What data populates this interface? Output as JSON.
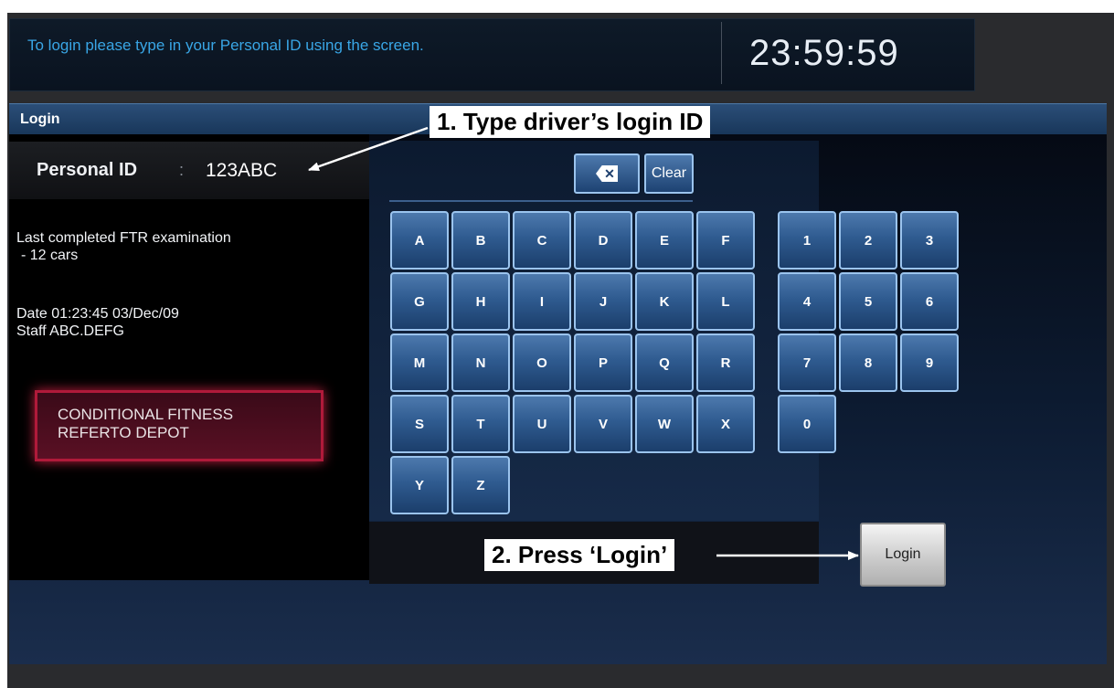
{
  "header": {
    "instruction": "To login please type in your Personal ID using the screen.",
    "clock": "23:59:59"
  },
  "login_panel": {
    "title": "Login",
    "personal_id_label": "Personal ID",
    "personal_id_colon": ":",
    "personal_id_value": "123ABC",
    "last_exam_line1": "Last completed FTR examination",
    "last_exam_line2": "- 12 cars",
    "date_line": "Date 01:23:45 03/Dec/09",
    "staff_line": "Staff ABC.DEFG",
    "conditional_line1": "CONDITIONAL FITNESS",
    "conditional_line2": "REFERTO DEPOT"
  },
  "keyboard": {
    "backspace_icon": "backspace-icon",
    "clear_label": "Clear",
    "letter_rows": [
      [
        "A",
        "B",
        "C",
        "D",
        "E",
        "F"
      ],
      [
        "G",
        "H",
        "I",
        "J",
        "K",
        "L"
      ],
      [
        "M",
        "N",
        "O",
        "P",
        "Q",
        "R"
      ],
      [
        "S",
        "T",
        "U",
        "V",
        "W",
        "X"
      ],
      [
        "Y",
        "Z"
      ]
    ],
    "number_rows": [
      [
        "1",
        "2",
        "3"
      ],
      [
        "4",
        "5",
        "6"
      ],
      [
        "7",
        "8",
        "9"
      ],
      [
        "0"
      ]
    ]
  },
  "login_button_label": "Login",
  "callouts": {
    "step1": "1. Type driver’s login ID",
    "step2": "2. Press ‘Login’"
  },
  "colors": {
    "accent_blue": "#39a6e6",
    "key_blue": "#2f5b90",
    "alert_red": "#b01a3a"
  }
}
